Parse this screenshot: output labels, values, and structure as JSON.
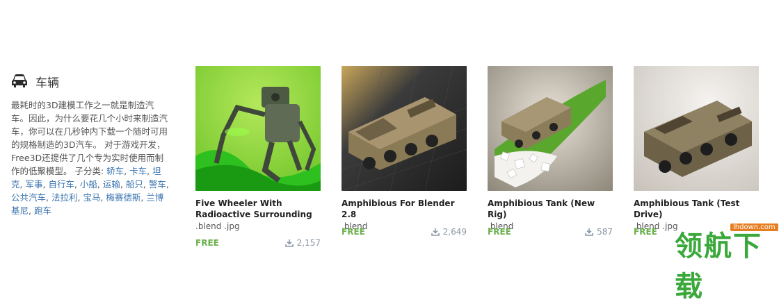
{
  "category": {
    "icon": "car-icon",
    "title": "车辆",
    "description": "最耗时的3D建模工作之一就是制造汽车。因此，为什么要花几个小时来制造汽车，你可以在几秒钟内下载一个随时可用的规格制造的3D汽车。 对于游戏开发，Free3D还提供了几个专为实时使用而制作的低聚模型。 子分类: ",
    "subcategories": [
      "轿车",
      "卡车",
      "坦克",
      "军事",
      "自行车",
      "小船",
      "运输",
      "船只",
      "警车",
      "公共汽车",
      "法拉利",
      "宝马",
      "梅赛德斯",
      "兰博基尼",
      "跑车"
    ]
  },
  "models": [
    {
      "title": "Five Wheeler With Radioactive Surrounding",
      "formats": ".blend .jpg",
      "price": "FREE",
      "downloads": "2,157"
    },
    {
      "title": "Amphibious For Blender 2.8",
      "formats": ".blend",
      "price": "FREE",
      "downloads": "2,649"
    },
    {
      "title": "Amphibious Tank (New Rig)",
      "formats": ".blend",
      "price": "FREE",
      "downloads": "587"
    },
    {
      "title": "Amphibious Tank (Test Drive)",
      "formats": ".blend .jpg",
      "price": "FREE",
      "downloads": ""
    }
  ],
  "watermark": {
    "text": "领航下载",
    "url": "lhdown.com"
  },
  "colors": {
    "free": "#6ab04c",
    "link": "#3a73b0"
  }
}
